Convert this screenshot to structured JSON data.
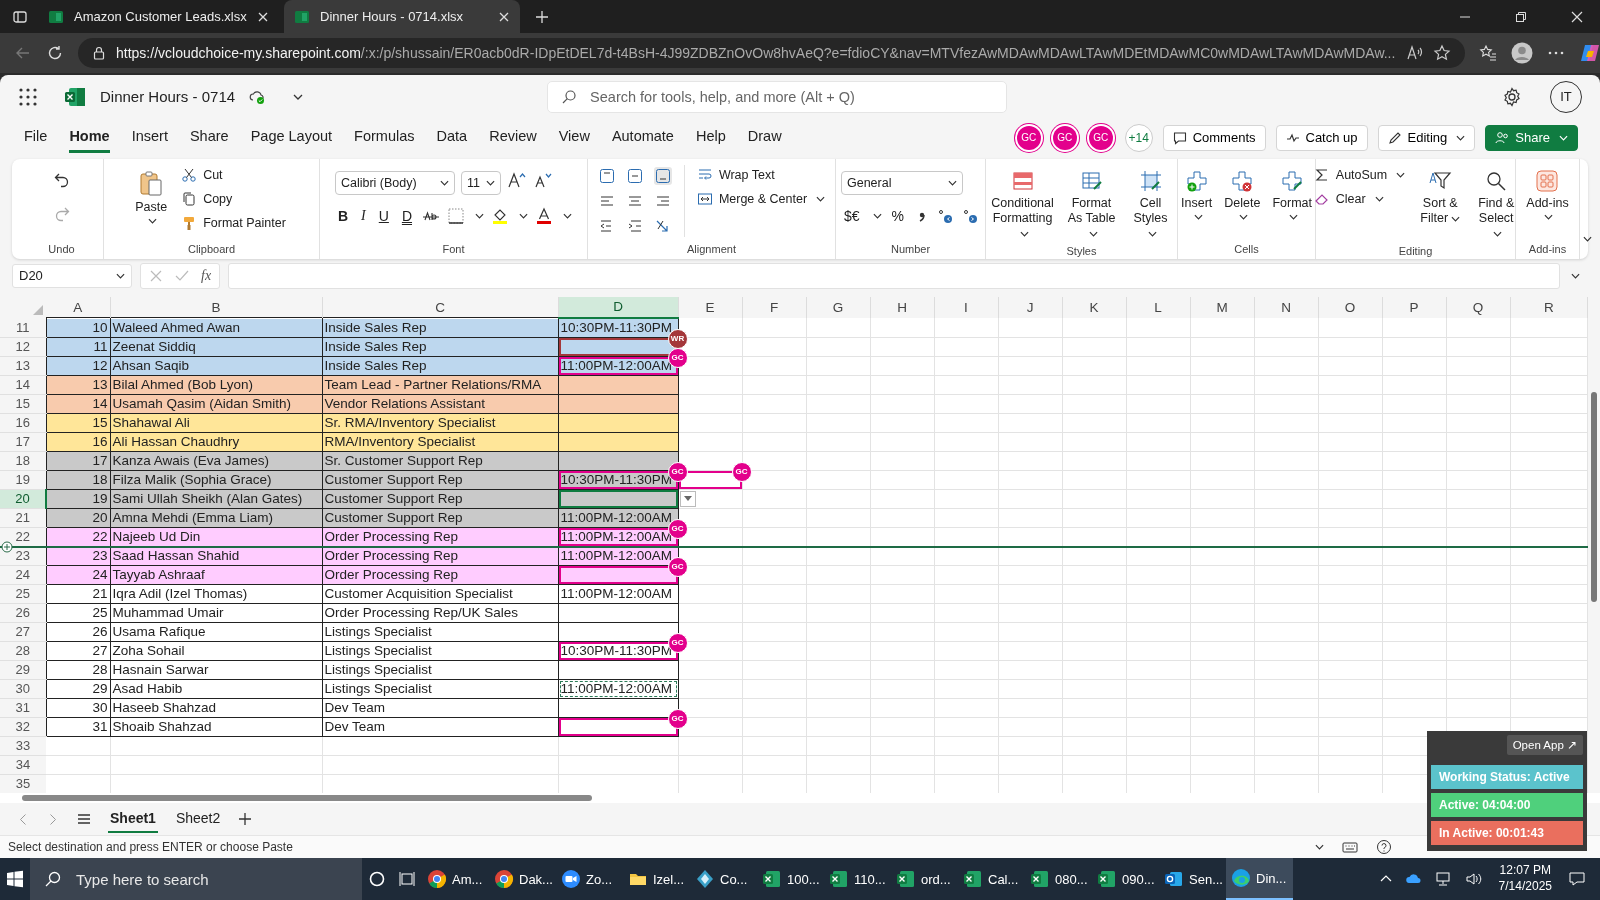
{
  "browser": {
    "tabs": [
      {
        "title": "Amazon Customer Leads.xlsx",
        "selected": false
      },
      {
        "title": "Dinner Hours - 0714.xlsx",
        "selected": true
      }
    ],
    "url_host": "https://vcloudchoice-my.sharepoint.com",
    "url_path": "/:x:/p/shussain/ER0acb0dR-IDpEtDEL7d-t4BsH-4J99ZDBZnOvOw8hvAeQ?e=fdioCY&nav=MTVfezAwMDAwMDAwLTAwMDEtMDAwMC0wMDAwLTAwMDAwMDAw..."
  },
  "app": {
    "title": "Dinner Hours - 0714",
    "search_placeholder": "Search for tools, help, and more (Alt + Q)",
    "account": "IT"
  },
  "menu": [
    {
      "label": "File",
      "selected": false
    },
    {
      "label": "Home",
      "selected": true
    },
    {
      "label": "Insert",
      "selected": false
    },
    {
      "label": "Share",
      "selected": false
    },
    {
      "label": "Page Layout",
      "selected": false
    },
    {
      "label": "Formulas",
      "selected": false
    },
    {
      "label": "Data",
      "selected": false
    },
    {
      "label": "Review",
      "selected": false
    },
    {
      "label": "View",
      "selected": false
    },
    {
      "label": "Automate",
      "selected": false
    },
    {
      "label": "Help",
      "selected": false
    },
    {
      "label": "Draw",
      "selected": false
    }
  ],
  "collaborators": [
    {
      "initials": "GC",
      "color": "#e3008c"
    },
    {
      "initials": "GC",
      "color": "#e3008c"
    },
    {
      "initials": "GC",
      "color": "#e3008c"
    }
  ],
  "more_collaborators": "+14",
  "actions": {
    "comments": "Comments",
    "catch_up": "Catch up",
    "editing": "Editing",
    "share": "Share"
  },
  "ribbon": {
    "undo": {
      "label": "Undo"
    },
    "clipboard": {
      "paste": "Paste",
      "cut": "Cut",
      "copy": "Copy",
      "format_painter": "Format Painter",
      "label": "Clipboard"
    },
    "font": {
      "family": "Calibri (Body)",
      "size": "11",
      "bold": "B",
      "italic": "I",
      "underline": "U",
      "double_underline": "D",
      "label": "Font"
    },
    "alignment": {
      "wrap": "Wrap Text",
      "merge": "Merge & Center",
      "label": "Alignment"
    },
    "number": {
      "format": "General",
      "currency": "$€",
      "percent": "%",
      "label": "Number"
    },
    "styles": {
      "conditional": "Conditional Formatting",
      "table": "Format As Table",
      "cell": "Cell Styles",
      "label": "Styles"
    },
    "cells": {
      "insert": "Insert",
      "delete": "Delete",
      "format": "Format",
      "label": "Cells"
    },
    "editing": {
      "autosum": "AutoSum",
      "clear": "Clear",
      "sort": "Sort & Filter",
      "find": "Find & Select",
      "label": "Editing"
    },
    "addins": {
      "button": "Add-ins",
      "label": "Add-ins"
    }
  },
  "formula_bar": {
    "name_box": "D20",
    "fx": "fx"
  },
  "grid": {
    "columns": [
      {
        "label": "A",
        "selected": false
      },
      {
        "label": "B",
        "selected": false
      },
      {
        "label": "C",
        "selected": false
      },
      {
        "label": "D",
        "selected": true
      },
      {
        "label": "E",
        "selected": false
      },
      {
        "label": "F",
        "selected": false
      },
      {
        "label": "G",
        "selected": false
      },
      {
        "label": "H",
        "selected": false
      },
      {
        "label": "I",
        "selected": false
      },
      {
        "label": "J",
        "selected": false
      },
      {
        "label": "K",
        "selected": false
      },
      {
        "label": "L",
        "selected": false
      },
      {
        "label": "M",
        "selected": false
      },
      {
        "label": "N",
        "selected": false
      },
      {
        "label": "O",
        "selected": false
      },
      {
        "label": "P",
        "selected": false
      },
      {
        "label": "Q",
        "selected": false
      },
      {
        "label": "R",
        "selected": false
      }
    ],
    "rows": [
      {
        "number": "11",
        "selected": false,
        "color": "#bdd7ee",
        "cells": [
          {
            "text": "10",
            "selected": false
          },
          {
            "text": "Waleed Ahmed Awan",
            "selected": false
          },
          {
            "text": "Inside Sales Rep",
            "selected": false
          },
          {
            "text": "10:30PM-11:30PM",
            "selected": false
          }
        ]
      },
      {
        "number": "12",
        "selected": false,
        "color": "#bdd7ee",
        "cells": [
          {
            "text": "11",
            "selected": false
          },
          {
            "text": "Zeenat Siddiq",
            "selected": false
          },
          {
            "text": "Inside Sales Rep",
            "selected": false
          },
          {
            "selected": false,
            "cursor": {
              "initials": "WR",
              "color": "#a4373a"
            }
          }
        ]
      },
      {
        "number": "13",
        "selected": false,
        "color": "#bdd7ee",
        "cells": [
          {
            "text": "12",
            "selected": false
          },
          {
            "text": "Ahsan Saqib",
            "selected": false
          },
          {
            "text": "Inside Sales Rep",
            "selected": false
          },
          {
            "text": "11:00PM-12:00AM",
            "selected": false,
            "cursor": {
              "initials": "GC",
              "color": "#e3008c"
            }
          }
        ]
      },
      {
        "number": "14",
        "selected": false,
        "color": "#f8cbad",
        "cells": [
          {
            "text": "13",
            "selected": false
          },
          {
            "text": "Bilal Ahmed (Bob Lyon)",
            "selected": false
          },
          {
            "text": "Team Lead - Partner Relations/RMA",
            "selected": false
          },
          {
            "selected": false
          }
        ]
      },
      {
        "number": "15",
        "selected": false,
        "color": "#f8cbad",
        "cells": [
          {
            "text": "14",
            "selected": false
          },
          {
            "text": "Usamah Qasim (Aidan Smith)",
            "selected": false
          },
          {
            "text": "Vendor Relations Assistant",
            "selected": false
          },
          {
            "selected": false
          }
        ]
      },
      {
        "number": "16",
        "selected": false,
        "color": "#ffe699",
        "cells": [
          {
            "text": "15",
            "selected": false
          },
          {
            "text": "Shahawal Ali",
            "selected": false
          },
          {
            "text": "Sr. RMA/Inventory Specialist",
            "selected": false
          },
          {
            "selected": false
          }
        ]
      },
      {
        "number": "17",
        "selected": false,
        "color": "#ffe699",
        "cells": [
          {
            "text": "16",
            "selected": false
          },
          {
            "text": "Ali Hassan Chaudhry",
            "selected": false
          },
          {
            "text": "RMA/Inventory Specialist",
            "selected": false
          },
          {
            "selected": false
          }
        ]
      },
      {
        "number": "18",
        "selected": false,
        "color": "#c9c9c9",
        "cells": [
          {
            "text": "17",
            "selected": false
          },
          {
            "text": "Kanza Awais (Eva James)",
            "selected": false
          },
          {
            "text": "Sr. Customer Support Rep",
            "selected": false
          },
          {
            "selected": false
          }
        ]
      },
      {
        "number": "19",
        "selected": false,
        "color": "#c9c9c9",
        "cells": [
          {
            "text": "18",
            "selected": false
          },
          {
            "text": "Filza Malik (Sophia Grace)",
            "selected": false
          },
          {
            "text": "Customer Support Rep",
            "selected": false
          },
          {
            "text": "10:30PM-11:30PM",
            "selected": false,
            "cursor": {
              "initials": "GC",
              "color": "#e3008c"
            }
          },
          {
            "selected": false,
            "cursor": {
              "initials": "GC",
              "color": "#e3008c"
            }
          }
        ]
      },
      {
        "number": "20",
        "selected": true,
        "color": "#c9c9c9",
        "cells": [
          {
            "text": "19",
            "selected": false
          },
          {
            "text": "Sami Ullah Sheikh (Alan Gates)",
            "selected": false
          },
          {
            "text": "Customer Support Rep",
            "selected": false
          },
          {
            "selected": true
          }
        ]
      },
      {
        "number": "21",
        "selected": false,
        "color": "#c9c9c9",
        "cells": [
          {
            "text": "20",
            "selected": false
          },
          {
            "text": "Amna Mehdi (Emma Liam)",
            "selected": false
          },
          {
            "text": "Customer Support Rep",
            "selected": false
          },
          {
            "text": "11:00PM-12:00AM",
            "selected": false
          }
        ]
      },
      {
        "number": "22",
        "selected": false,
        "color": "#ffccff",
        "cells": [
          {
            "text": "22",
            "selected": false
          },
          {
            "text": "Najeeb Ud Din",
            "selected": false
          },
          {
            "text": "Order Processing Rep",
            "selected": false
          },
          {
            "text": "11:00PM-12:00AM",
            "selected": false,
            "cursor": {
              "initials": "GC",
              "color": "#e3008c"
            }
          }
        ]
      },
      {
        "number": "23",
        "selected": false,
        "color": "#ffccff",
        "cells": [
          {
            "text": "23",
            "selected": false
          },
          {
            "text": "Saad Hassan Shahid",
            "selected": false
          },
          {
            "text": "Order Processing Rep",
            "selected": false
          },
          {
            "text": "11:00PM-12:00AM",
            "selected": false
          }
        ]
      },
      {
        "number": "24",
        "selected": false,
        "color": "#ffccff",
        "cells": [
          {
            "text": "24",
            "selected": false
          },
          {
            "text": "Tayyab Ashraaf",
            "selected": false
          },
          {
            "text": "Order Processing Rep",
            "selected": false
          },
          {
            "selected": false,
            "cursor": {
              "initials": "GC",
              "color": "#e3008c"
            }
          }
        ]
      },
      {
        "number": "25",
        "selected": false,
        "color": "#ffffff",
        "cells": [
          {
            "text": "21",
            "selected": false
          },
          {
            "text": "Iqra Adil (Izel Thomas)",
            "selected": false
          },
          {
            "text": "Customer Acquisition Specialist",
            "selected": false
          },
          {
            "text": "11:00PM-12:00AM",
            "selected": false
          }
        ]
      },
      {
        "number": "26",
        "selected": false,
        "color": "#ffffff",
        "cells": [
          {
            "text": "25",
            "selected": false
          },
          {
            "text": "Muhammad Umair",
            "selected": false
          },
          {
            "text": "Order Processing Rep/UK Sales",
            "selected": false
          },
          {
            "selected": false
          }
        ]
      },
      {
        "number": "27",
        "selected": false,
        "color": "#ffffff",
        "cells": [
          {
            "text": "26",
            "selected": false
          },
          {
            "text": "Usama Rafique",
            "selected": false
          },
          {
            "text": "Listings Specialist",
            "selected": false
          },
          {
            "selected": false
          }
        ]
      },
      {
        "number": "28",
        "selected": false,
        "color": "#ffffff",
        "cells": [
          {
            "text": "27",
            "selected": false
          },
          {
            "text": "Zoha Sohail",
            "selected": false
          },
          {
            "text": "Listings Specialist",
            "selected": false
          },
          {
            "text": "10:30PM-11:30PM",
            "selected": false,
            "cursor": {
              "initials": "GC",
              "color": "#e3008c"
            }
          }
        ]
      },
      {
        "number": "29",
        "selected": false,
        "color": "#ffffff",
        "cells": [
          {
            "text": "28",
            "selected": false
          },
          {
            "text": "Hasnain Sarwar",
            "selected": false
          },
          {
            "text": "Listings Specialist",
            "selected": false
          },
          {
            "selected": false
          }
        ]
      },
      {
        "number": "30",
        "selected": false,
        "color": "#ffffff",
        "cells": [
          {
            "text": "29",
            "selected": false
          },
          {
            "text": "Asad Habib",
            "selected": false
          },
          {
            "text": "Listings Specialist",
            "selected": false
          },
          {
            "text": "11:00PM-12:00AM",
            "selected": false,
            "copied": true
          }
        ]
      },
      {
        "number": "31",
        "selected": false,
        "color": "#ffffff",
        "cells": [
          {
            "text": "30",
            "selected": false
          },
          {
            "text": "Haseeb Shahzad",
            "selected": false
          },
          {
            "text": "Dev Team",
            "selected": false
          },
          {
            "selected": false
          }
        ]
      },
      {
        "number": "32",
        "selected": false,
        "color": "#ffffff",
        "cells": [
          {
            "text": "31",
            "selected": false
          },
          {
            "text": "Shoaib Shahzad",
            "selected": false
          },
          {
            "text": "Dev Team",
            "selected": false
          },
          {
            "selected": false,
            "cursor": {
              "initials": "GC",
              "color": "#e3008c"
            }
          }
        ]
      },
      {
        "number": "33",
        "selected": false
      },
      {
        "number": "34",
        "selected": false
      },
      {
        "number": "35",
        "selected": false
      }
    ]
  },
  "sheets": [
    {
      "name": "Sheet1",
      "selected": true
    },
    {
      "name": "Sheet2",
      "selected": false
    }
  ],
  "status": "Select destination and press ENTER or choose Paste",
  "widget": {
    "open_app": "Open App ↗",
    "status": "Working Status: Active",
    "active": "Active: 04:04:00",
    "inactive": "In Active: 00:01:43"
  },
  "taskbar": {
    "search_placeholder": "Type here to search",
    "apps": [
      {
        "label": "Am...",
        "kind": "chrome",
        "selected": false
      },
      {
        "label": "Dak...",
        "kind": "chrome",
        "selected": false
      },
      {
        "label": "Zo...",
        "kind": "zoom",
        "selected": false
      },
      {
        "label": "Izel...",
        "kind": "folder",
        "selected": false
      },
      {
        "label": "Co...",
        "kind": "diamond",
        "selected": false
      },
      {
        "label": "100...",
        "kind": "excel",
        "selected": false
      },
      {
        "label": "110...",
        "kind": "excel",
        "selected": false
      },
      {
        "label": "ord...",
        "kind": "excel",
        "selected": false
      },
      {
        "label": "Cal...",
        "kind": "excel",
        "selected": false
      },
      {
        "label": "080...",
        "kind": "excel",
        "selected": false
      },
      {
        "label": "090...",
        "kind": "excel",
        "selected": false
      },
      {
        "label": "Sen...",
        "kind": "outlook",
        "selected": false
      },
      {
        "label": "Din...",
        "kind": "edge",
        "selected": true
      }
    ],
    "time": "12:07 PM",
    "date": "7/14/2025"
  }
}
